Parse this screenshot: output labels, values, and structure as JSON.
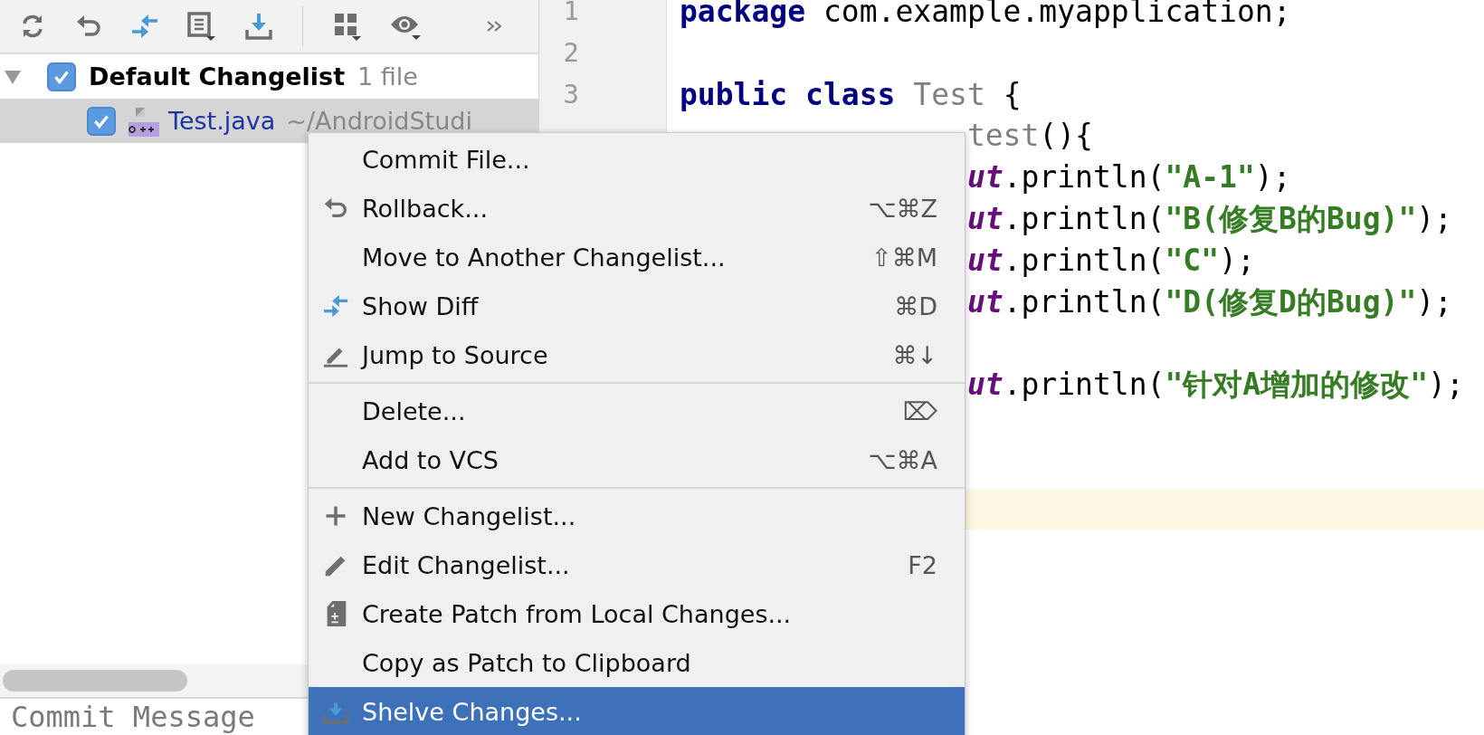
{
  "changes_panel": {
    "changelist": {
      "label": "Default Changelist",
      "count": "1 file",
      "checked": true,
      "expanded": true,
      "children": [
        {
          "name": "Test.java",
          "path": "~/AndroidStudi",
          "checked": true,
          "selected": true
        }
      ]
    },
    "commit_message": {
      "placeholder": "Commit Message"
    }
  },
  "editor": {
    "lines": [
      {
        "number": "1",
        "current": false,
        "partial": false,
        "tokens": [
          {
            "kind": "keyword",
            "text": "package"
          },
          {
            "kind": "plain",
            "text": " com.example.myapplication;"
          }
        ]
      },
      {
        "number": "2",
        "current": false
      },
      {
        "number": "3",
        "current": false,
        "partial": false,
        "tokens": [
          {
            "kind": "keyword",
            "text": "public class"
          },
          {
            "kind": "unused",
            "text": " Test"
          },
          {
            "kind": "plain",
            "text": " {"
          }
        ]
      },
      {
        "current": false,
        "partial": true,
        "tokens": [
          {
            "kind": "unused",
            "text": "test"
          },
          {
            "kind": "plain",
            "text": "(){"
          }
        ]
      },
      {
        "current": false,
        "partial": true,
        "tokens": [
          {
            "kind": "field",
            "text": "ut"
          },
          {
            "kind": "plain",
            "text": ".println("
          },
          {
            "kind": "string",
            "text": "\"A-1\""
          },
          {
            "kind": "plain",
            "text": ");"
          }
        ]
      },
      {
        "current": false,
        "partial": true,
        "tokens": [
          {
            "kind": "field",
            "text": "ut"
          },
          {
            "kind": "plain",
            "text": ".println("
          },
          {
            "kind": "string",
            "text": "\"B(修复B的Bug)\""
          },
          {
            "kind": "plain",
            "text": ");"
          }
        ]
      },
      {
        "current": false,
        "partial": true,
        "tokens": [
          {
            "kind": "field",
            "text": "ut"
          },
          {
            "kind": "plain",
            "text": ".println("
          },
          {
            "kind": "string",
            "text": "\"C\""
          },
          {
            "kind": "plain",
            "text": ");"
          }
        ]
      },
      {
        "current": false,
        "partial": true,
        "tokens": [
          {
            "kind": "field",
            "text": "ut"
          },
          {
            "kind": "plain",
            "text": ".println("
          },
          {
            "kind": "string",
            "text": "\"D(修复D的Bug)\""
          },
          {
            "kind": "plain",
            "text": ");"
          }
        ]
      },
      {
        "current": false
      },
      {
        "current": false,
        "partial": true,
        "tokens": [
          {
            "kind": "field",
            "text": "ut"
          },
          {
            "kind": "plain",
            "text": ".println("
          },
          {
            "kind": "string",
            "text": "\"针对A增加的修改\""
          },
          {
            "kind": "plain",
            "text": ");"
          }
        ]
      },
      {
        "current": false
      },
      {
        "current": false
      },
      {
        "current": true
      }
    ]
  },
  "context_menu": {
    "groups": [
      [
        {
          "label": "Commit File...",
          "selected": false
        },
        {
          "label": "Rollback...",
          "shortcut": "⌥⌘Z",
          "selected": false
        },
        {
          "label": "Move to Another Changelist...",
          "shortcut": "⇧⌘M",
          "selected": false
        },
        {
          "label": "Show Diff",
          "shortcut": "⌘D",
          "selected": false
        },
        {
          "label": "Jump to Source",
          "shortcut": "⌘↓",
          "selected": false
        }
      ],
      [
        {
          "label": "Delete...",
          "shortcut": "⌦",
          "selected": false
        },
        {
          "label": "Add to VCS",
          "shortcut": "⌥⌘A",
          "selected": false
        }
      ],
      [
        {
          "label": "New Changelist...",
          "selected": false
        },
        {
          "label": "Edit Changelist...",
          "shortcut": "F2",
          "selected": false
        },
        {
          "label": "Create Patch from Local Changes...",
          "selected": false
        },
        {
          "label": "Copy as Patch to Clipboard",
          "selected": false
        },
        {
          "label": "Shelve Changes...",
          "selected": true
        }
      ]
    ]
  }
}
